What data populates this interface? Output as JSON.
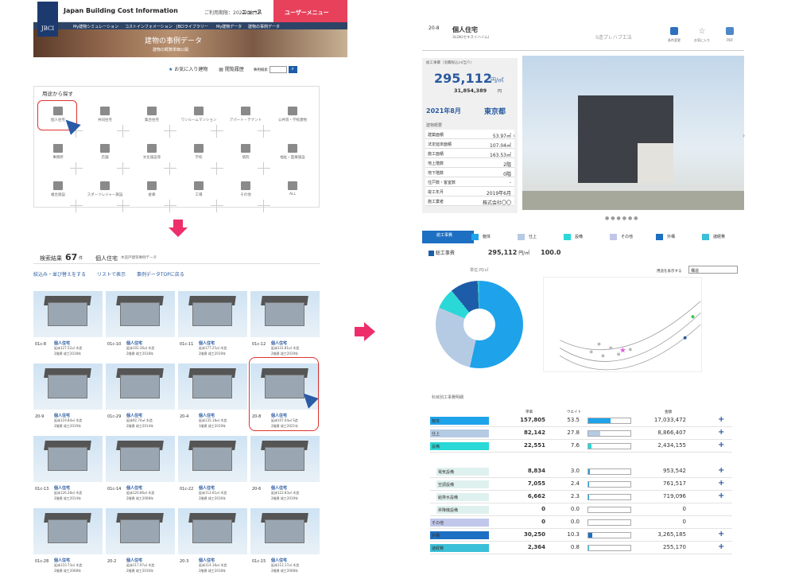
{
  "site": {
    "logo": "JBCI",
    "brand": "Japan Building Cost Information",
    "updated": "ご利用期限：2022/08/31",
    "news": "ニュース",
    "user_menu": "ユーザーメニュー",
    "nav": [
      "My建物シミュレーション",
      "コストインフォメーション",
      "JBCIライブラリー",
      "My建物データ",
      "建物の事例データ"
    ],
    "banner_title": "建物の事例データ",
    "banner_sub": "建物の概算単価公開"
  },
  "toolbar": {
    "fav": "お気に入り建物",
    "history": "閲覧履歴",
    "search_label": "事例検索"
  },
  "category": {
    "title": "用途から探す",
    "items": [
      "個人住宅",
      "共同住宅",
      "集合住宅",
      "ワンルームマンション",
      "アパート・テナント",
      "公共等・学校建物",
      "事務所",
      "店舗",
      "文化施設等",
      "学校",
      "病院",
      "福祉・医療施設",
      "複合施設",
      "スポーツレジャー施設",
      "倉庫",
      "工場",
      "その他",
      "ALL"
    ]
  },
  "results": {
    "count_label": "検索結果",
    "count": "67",
    "unit": "件",
    "kind": "個人住宅",
    "sub": "木造戸建等事例データ",
    "filter": "絞込み・並び替えをする",
    "list": "リストで表示",
    "top": "事例データTOPに戻る",
    "cards": [
      {
        "id": "01c-8",
        "title": "個人住宅",
        "d1": "延床127.52㎡ 木造",
        "d2": "2階建 竣工2018年"
      },
      {
        "id": "01c-10",
        "title": "個人住宅",
        "d1": "延床102.36㎡ 木造",
        "d2": "2階建 竣工2018年"
      },
      {
        "id": "01c-11",
        "title": "個人住宅",
        "d1": "延床177.25㎡ 木造",
        "d2": "2階建 竣工2019年"
      },
      {
        "id": "01c-12",
        "title": "個人住宅",
        "d1": "延床131.81㎡ 木造",
        "d2": "2階建 竣工2019年"
      },
      {
        "id": "20-9",
        "title": "個人住宅",
        "d1": "延床119.84㎡ 木造",
        "d2": "2階建 竣工2019年"
      },
      {
        "id": "01c-29",
        "title": "個人住宅",
        "d1": "延床92.74㎡ 木造",
        "d2": "2階建 竣工2014年"
      },
      {
        "id": "20-4",
        "title": "個人住宅",
        "d1": "延床135.18㎡ 木造",
        "d2": "1階建 竣工2019年"
      },
      {
        "id": "20-8",
        "title": "個人住宅",
        "d1": "延床107.04㎡ S造",
        "d2": "2階建 竣工2021年"
      },
      {
        "id": "01c-13",
        "title": "個人住宅",
        "d1": "延床126.28㎡ 木造",
        "d2": "2階建 竣工2014年"
      },
      {
        "id": "01c-14",
        "title": "個人住宅",
        "d1": "延床120.86㎡ 木造",
        "d2": "2階建 竣工2008年"
      },
      {
        "id": "01c-22",
        "title": "個人住宅",
        "d1": "延床112.61㎡ 木造",
        "d2": "2階建 竣工2016年"
      },
      {
        "id": "20-6",
        "title": "個人住宅",
        "d1": "延床122.83㎡ 木造",
        "d2": "2階建 竣工2019年"
      },
      {
        "id": "01c-28",
        "title": "個人住宅",
        "d1": "延床110.73㎡ 木造",
        "d2": "2階建 竣工2008年"
      },
      {
        "id": "20-2",
        "title": "個人住宅",
        "d1": "延床117.97㎡ 木造",
        "d2": "2階建 竣工2016年"
      },
      {
        "id": "20-3",
        "title": "個人住宅",
        "d1": "延床114.18㎡ 木造",
        "d2": "2階建 竣工2018年"
      },
      {
        "id": "01c-15",
        "title": "個人住宅",
        "d1": "延床112.17㎡ 木造",
        "d2": "2階建 竣工2008年"
      }
    ]
  },
  "detail": {
    "num": "20-8",
    "name": "個人住宅",
    "type": "3LDK(セキスイハイム)",
    "method": "S造プレハブ工法",
    "icons": [
      "条件変更",
      "お気に入り",
      "PDF"
    ],
    "cost_label": "総工事費（消費税込/㎡当り）",
    "cost": "295,112",
    "cost_unit": "円/㎡",
    "total": "31,854,389",
    "total_unit": "円",
    "year": "2021年8月",
    "pref": "東京都",
    "spec_title": "建物概要",
    "specs": [
      [
        "建築面積",
        "53.97㎡"
      ],
      [
        "法定延床面積",
        "107.04㎡"
      ],
      [
        "施工面積",
        "163.53㎡"
      ],
      [
        "地上階数",
        "2階"
      ],
      [
        "地下階数",
        "0階"
      ],
      [
        "住戸数・客室数",
        "-"
      ],
      [
        "竣工年月",
        "2019年6月"
      ],
      [
        "施工業者",
        "株式会社〇〇"
      ]
    ],
    "tabs": [
      "総工事費",
      "躯体",
      "仕上",
      "設備",
      "その他",
      "外構",
      "諸経費"
    ],
    "sum_label": "総工事費",
    "sum_val": "295,112",
    "sum_unit": "円/㎡",
    "sum_pct": "100.0",
    "chart_label": "単位:円/㎡",
    "select_label": "用途を表示する",
    "select_val": "構造",
    "cost_table_title": "科目別工事費明細",
    "cols": [
      "単価",
      "ウエイト",
      "金額"
    ],
    "rows": [
      {
        "name": "躯体",
        "price": "157,805",
        "pct": "53.5",
        "amount": "17,033,472",
        "bar": 53.5,
        "color": "#1ea3ea"
      },
      {
        "name": "仕上",
        "price": "82,142",
        "pct": "27.8",
        "amount": "8,866,407",
        "bar": 27.8,
        "color": "#b5cbe4"
      },
      {
        "name": "設備",
        "price": "22,551",
        "pct": "7.6",
        "amount": "2,434,155",
        "bar": 7.6,
        "color": "#2ad8d8"
      },
      {
        "name": "電気設備",
        "price": "8,834",
        "pct": "3.0",
        "amount": "953,542",
        "bar": 3,
        "color": "#dff1ee"
      },
      {
        "name": "空調設備",
        "price": "7,055",
        "pct": "2.4",
        "amount": "761,517",
        "bar": 2.4,
        "color": "#dff1ee"
      },
      {
        "name": "給排水設備",
        "price": "6,662",
        "pct": "2.3",
        "amount": "719,096",
        "bar": 2.3,
        "color": "#dff1ee"
      },
      {
        "name": "昇降機設備",
        "price": "0",
        "pct": "0.0",
        "amount": "0",
        "bar": 0,
        "color": "#dff1ee"
      },
      {
        "name": "その他",
        "price": "0",
        "pct": "0.0",
        "amount": "0",
        "bar": 0,
        "color": "#c0c7ea"
      },
      {
        "name": "外構",
        "price": "30,250",
        "pct": "10.3",
        "amount": "3,265,185",
        "bar": 10.3,
        "color": "#1d6fc2"
      },
      {
        "name": "諸経費",
        "price": "2,364",
        "pct": "0.8",
        "amount": "255,170",
        "bar": 0.8,
        "color": "#3ac0d8"
      }
    ]
  }
}
